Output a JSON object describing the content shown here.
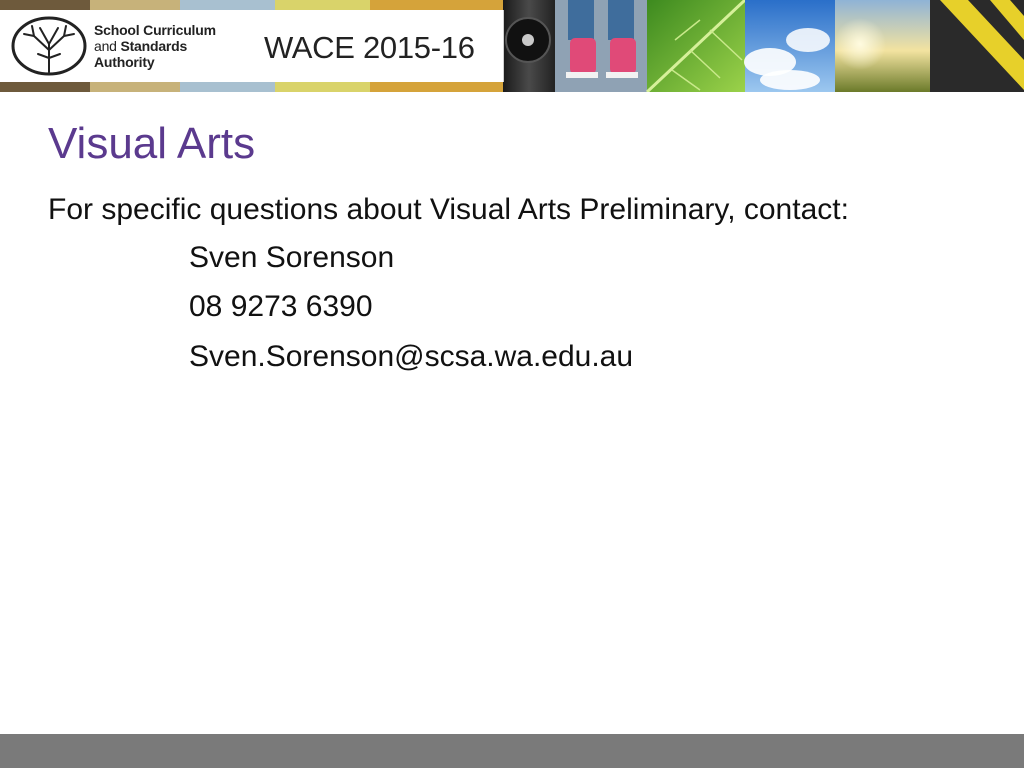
{
  "banner": {
    "org_line1": "School Curriculum",
    "org_line2_prefix": "and ",
    "org_line2_bold": "Standards",
    "org_line3": "Authority",
    "program_title": "WACE 2015-16"
  },
  "slide": {
    "title": "Visual Arts",
    "intro": "For specific questions about Visual Arts Preliminary, contact:",
    "contact": {
      "name": "Sven Sorenson",
      "phone": "08 9273 6390",
      "email": "Sven.Sorenson@scsa.wa.edu.au"
    }
  },
  "colors": {
    "title": "#5b3a8e",
    "body_text": "#111111",
    "footer_bar": "#7a7a7a",
    "banner_bg": "#2b2b2b"
  },
  "icons": {
    "logo": "tree-logo-icon"
  }
}
